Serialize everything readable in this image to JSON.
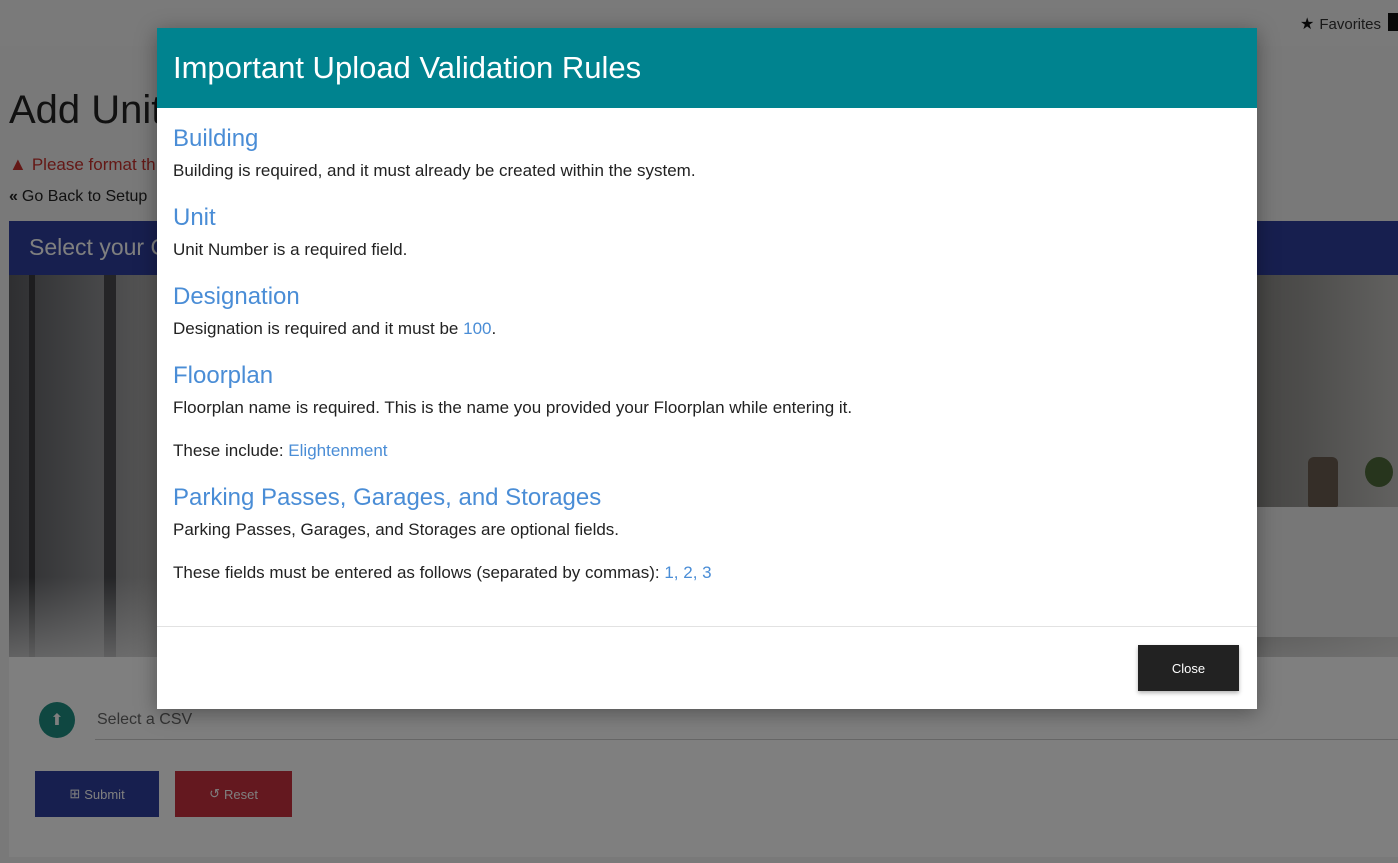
{
  "topbar": {
    "favorites_label": "Favorites",
    "favorites_icon": "star-icon",
    "building_icon": "building-icon"
  },
  "page": {
    "title": "Add Unit",
    "warning_text": "Please format th",
    "warning_icon": "warning-triangle-icon",
    "goback_label": "Go Back to Setup",
    "goback_icon": "double-chevron-left-icon",
    "card_header": "Select your C"
  },
  "upload": {
    "icon": "cloud-upload-icon",
    "placeholder": "Select a CSV",
    "submit_label": "Submit",
    "submit_icon": "plus-square-icon",
    "reset_label": "Reset",
    "reset_icon": "undo-icon"
  },
  "modal": {
    "title": "Important Upload Validation Rules",
    "sections": [
      {
        "title": "Building",
        "text": "Building is required, and it must already be created within the system."
      },
      {
        "title": "Unit",
        "text": "Unit Number is a required field."
      },
      {
        "title": "Designation",
        "text_prefix": "Designation is required and it must be ",
        "highlight": "100",
        "text_suffix": "."
      },
      {
        "title": "Floorplan",
        "text": "Floorplan name is required. This is the name you provided your Floorplan while entering it.",
        "text2_prefix": "These include: ",
        "highlight": "Elightenment"
      },
      {
        "title": "Parking Passes, Garages, and Storages",
        "text": "Parking Passes, Garages, and Storages are optional fields.",
        "text2_prefix": "These fields must be entered as follows (separated by commas): ",
        "highlight": "1, 2, 3"
      }
    ],
    "close_label": "Close"
  },
  "colors": {
    "modal_header": "#00838f",
    "section_title": "#4a8dd6",
    "card_header": "#2f3f9e",
    "reset": "#c9303e",
    "warning": "#c9302c"
  }
}
